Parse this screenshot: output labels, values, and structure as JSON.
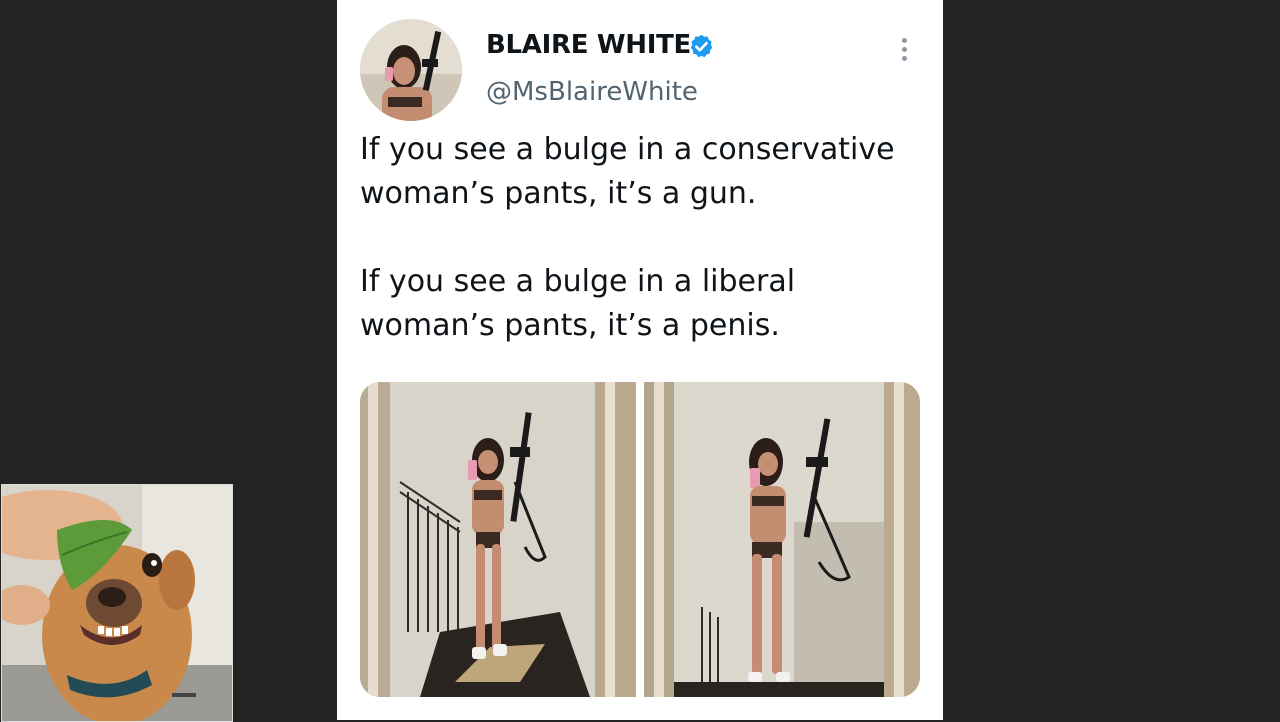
{
  "tweet": {
    "display_name": "BLAIRE WHITE",
    "handle": "@MsBlaireWhite",
    "verified_icon": "verified-badge-icon",
    "more_icon": "more-options-icon",
    "paragraphs": [
      "If you see a bulge in a conservative\nwoman’s pants, it’s a gun.",
      "If you see a bulge in a liberal\nwoman’s pants, it’s a penis."
    ],
    "media": [
      {
        "name": "mirror-selfie-photo-1"
      },
      {
        "name": "mirror-selfie-photo-2"
      }
    ]
  },
  "colors": {
    "background": "#232323",
    "card": "#ffffff",
    "name_text": "#0f1419",
    "handle_text": "#536471",
    "verified_blue": "#1d9bf0"
  },
  "overlay": {
    "name": "dog-with-leaf-reaction-image"
  }
}
